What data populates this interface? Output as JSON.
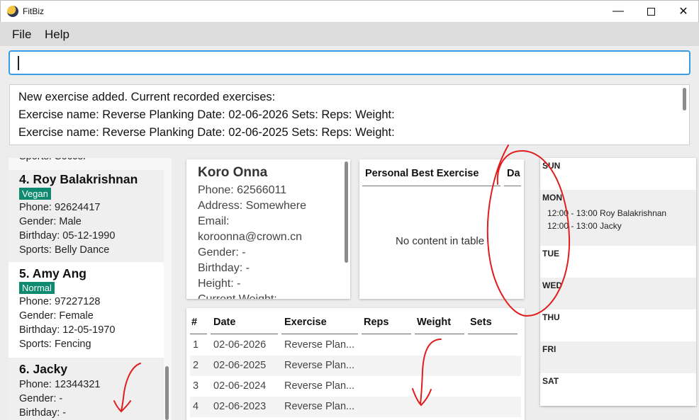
{
  "window": {
    "title": "FitBiz"
  },
  "menu": {
    "file": "File",
    "help": "Help"
  },
  "command": {
    "value": ""
  },
  "result": {
    "lines": [
      "New exercise added. Current recorded exercises:",
      "Exercise name: Reverse Planking Date: 02-06-2026 Sets:  Reps:  Weight:",
      "Exercise name: Reverse Planking Date: 02-06-2025 Sets:  Reps:  Weight:"
    ]
  },
  "people": {
    "partial_line": "Sports: Soccer",
    "cards": [
      {
        "name": "4.  Roy Balakrishnan",
        "tag": "Vegan",
        "phone": "Phone: 92624417",
        "gender": "Gender: Male",
        "birthday": "Birthday: 05-12-1990",
        "sports": "Sports: Belly Dance"
      },
      {
        "name": "5.  Amy Ang",
        "tag": "Normal",
        "phone": "Phone: 97227128",
        "gender": "Gender: Female",
        "birthday": "Birthday: 12-05-1970",
        "sports": "Sports: Fencing"
      },
      {
        "name": "6.  Jacky",
        "phone": "Phone: 12344321",
        "gender": "Gender: -",
        "birthday": "Birthday: -"
      }
    ]
  },
  "profile": {
    "name": "Koro Onna",
    "phone": "Phone: 62566011",
    "address": "Address: Somewhere",
    "email_label": "Email:",
    "email": "koroonna@crown.cn",
    "gender": "Gender: -",
    "birthday": "Birthday: -",
    "height": "Height: -",
    "current_weight": "Current Weight:"
  },
  "personal_best": {
    "col_exercise": "Personal Best Exercise",
    "col_date": "Da",
    "empty": "No content in table"
  },
  "exercises": {
    "headers": [
      "#",
      "Date",
      "Exercise",
      "Reps",
      "Weight",
      "Sets"
    ],
    "rows": [
      {
        "num": "1",
        "date": "02-06-2026",
        "exercise": "Reverse Plan..."
      },
      {
        "num": "2",
        "date": "02-06-2025",
        "exercise": "Reverse Plan..."
      },
      {
        "num": "3",
        "date": "02-06-2024",
        "exercise": "Reverse Plan..."
      },
      {
        "num": "4",
        "date": "02-06-2023",
        "exercise": "Reverse Plan..."
      }
    ]
  },
  "schedule": {
    "days": [
      "SUN",
      "MON",
      "TUE",
      "WED",
      "THU",
      "FRI",
      "SAT"
    ],
    "mon_appointments": [
      "12:00 - 13:00 Roy Balakrishnan",
      "12:00 - 13:00 Jacky"
    ]
  },
  "colors": {
    "accent": "#3a9be2",
    "tag": "#0d8a6f",
    "annotation": "#e01e1e"
  }
}
